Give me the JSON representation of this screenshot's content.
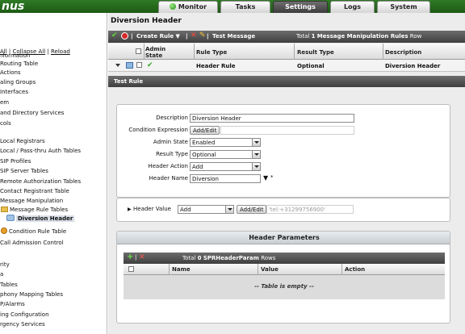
{
  "app": {
    "logo_text": "nus"
  },
  "tabs": {
    "monitor": "Monitor",
    "tasks": "Tasks",
    "settings": "Settings",
    "logs": "Logs",
    "system": "System"
  },
  "nav": {
    "expand_all": "All",
    "collapse_all": "Collapse All",
    "reload": "Reload",
    "items": [
      "nformation",
      "Routing Table",
      "Actions",
      "aling Groups",
      "Interfaces",
      "em",
      "and Directory Services",
      "cols",
      "Local Registrars",
      "Local / Pass-thru Auth Tables",
      "SIP Profiles",
      "SIP Server Tables",
      "Remote Authorization Tables",
      "Contact Registrant Table",
      "Message Manipulation",
      "Message Rule Tables",
      "Diversion Header",
      "Condition Rule Table",
      "Call Admission Control",
      "rity",
      "a",
      "Tables",
      "phony Mapping Tables",
      "P/Alarms",
      "ing Configuration",
      "rgency Services"
    ]
  },
  "panel": {
    "title": "Diversion Header",
    "toolbar": {
      "create_rule": "Create Rule",
      "test_message": "Test Message",
      "total_prefix": "Total",
      "total_count": "1",
      "total_suffix_bold": "Message Manipulation Rules",
      "total_suffix": "Row"
    },
    "grid": {
      "col_admin_state": "Admin State",
      "col_rule_type": "Rule Type",
      "col_result_type": "Result Type",
      "col_description": "Description",
      "row": {
        "rule_type": "Header Rule",
        "result_type": "Optional",
        "description": "Diversion Header"
      }
    },
    "section_bar": "Test Rule"
  },
  "form": {
    "description_label": "Description",
    "description_value": "Diversion Header",
    "condition_label": "Condition Expression",
    "condition_button": "Add/Edit",
    "admin_state_label": "Admin State",
    "admin_state_value": "Enabled",
    "result_type_label": "Result Type",
    "result_type_value": "Optional",
    "header_action_label": "Header Action",
    "header_action_value": "Add",
    "header_name_label": "Header Name",
    "header_name_value": "Diversion",
    "required_mark": "*"
  },
  "header_value": {
    "label": "Header Value",
    "select_value": "Add",
    "button": "Add/Edit",
    "value": "'tel:+31299756900'"
  },
  "header_params": {
    "title": "Header Parameters",
    "total_prefix": "Total",
    "total_count": "0",
    "total_name": "SPRHeaderParam",
    "total_suffix": "Rows",
    "col_name": "Name",
    "col_value": "Value",
    "col_action": "Action",
    "empty_text": "-- Table is empty --"
  },
  "colors": {
    "topbar_green": "#2f7a25",
    "toolbar_dark": "#4f4f4f",
    "panel_bg": "#ececec"
  }
}
